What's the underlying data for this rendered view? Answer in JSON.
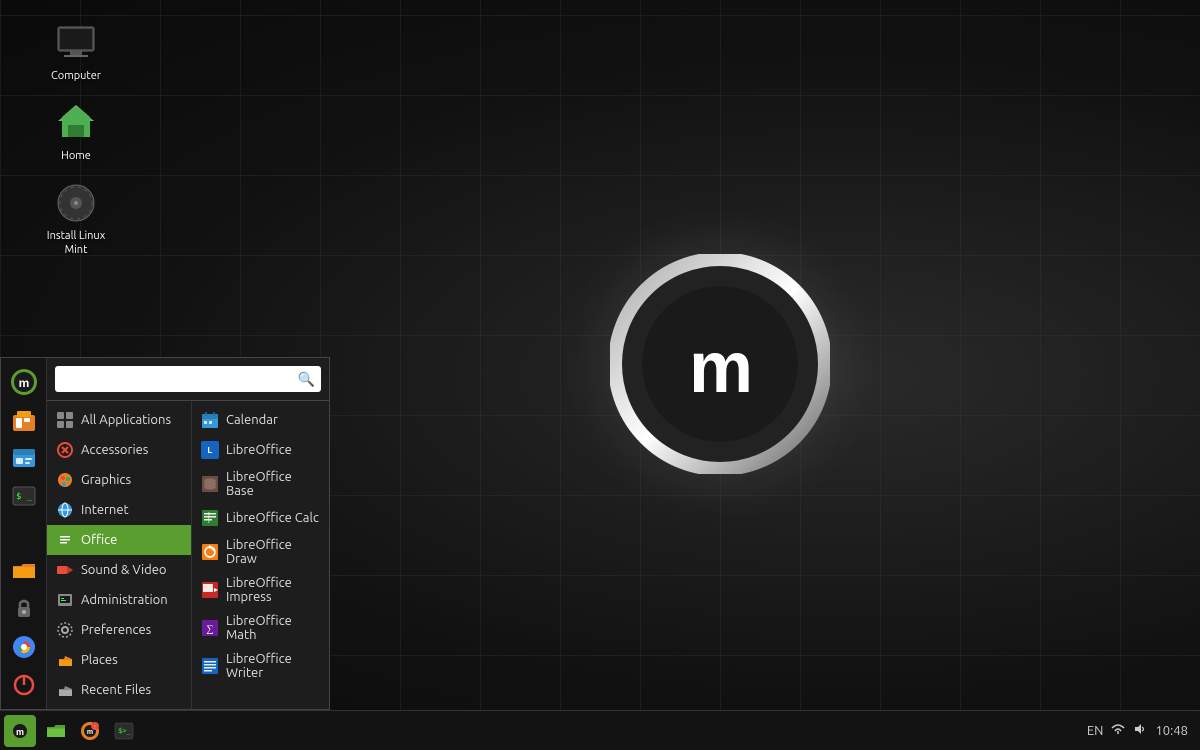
{
  "desktop": {
    "background": "dark grid",
    "icons": [
      {
        "id": "computer",
        "label": "Computer",
        "type": "computer"
      },
      {
        "id": "home",
        "label": "Home",
        "type": "folder-green"
      },
      {
        "id": "install",
        "label": "Install Linux Mint",
        "type": "dvd"
      }
    ]
  },
  "start_menu": {
    "search_placeholder": "",
    "categories": [
      {
        "id": "all-apps",
        "label": "All Applications",
        "icon": "grid"
      },
      {
        "id": "accessories",
        "label": "Accessories",
        "icon": "accessories"
      },
      {
        "id": "graphics",
        "label": "Graphics",
        "icon": "graphics"
      },
      {
        "id": "internet",
        "label": "Internet",
        "icon": "internet"
      },
      {
        "id": "office",
        "label": "Office",
        "icon": "office",
        "active": true
      },
      {
        "id": "sound-video",
        "label": "Sound & Video",
        "icon": "sound"
      },
      {
        "id": "administration",
        "label": "Administration",
        "icon": "admin"
      },
      {
        "id": "preferences",
        "label": "Preferences",
        "icon": "preferences"
      },
      {
        "id": "places",
        "label": "Places",
        "icon": "places"
      },
      {
        "id": "recent-files",
        "label": "Recent Files",
        "icon": "recent"
      }
    ],
    "apps": [
      {
        "id": "calendar",
        "label": "Calendar",
        "icon": "calendar"
      },
      {
        "id": "libreoffice",
        "label": "LibreOffice",
        "icon": "lo-main"
      },
      {
        "id": "libreoffice-base",
        "label": "LibreOffice Base",
        "icon": "lo-base"
      },
      {
        "id": "libreoffice-calc",
        "label": "LibreOffice Calc",
        "icon": "lo-calc"
      },
      {
        "id": "libreoffice-draw",
        "label": "LibreOffice Draw",
        "icon": "lo-draw"
      },
      {
        "id": "libreoffice-impress",
        "label": "LibreOffice Impress",
        "icon": "lo-impress"
      },
      {
        "id": "libreoffice-math",
        "label": "LibreOffice Math",
        "icon": "lo-math"
      },
      {
        "id": "libreoffice-writer",
        "label": "LibreOffice Writer",
        "icon": "lo-writer"
      }
    ]
  },
  "taskbar": {
    "left_buttons": [
      {
        "id": "mint-menu",
        "icon": "mint"
      },
      {
        "id": "files",
        "icon": "folder"
      },
      {
        "id": "firefox",
        "icon": "firefox"
      },
      {
        "id": "terminal",
        "icon": "terminal"
      }
    ],
    "tray": {
      "keyboard": "EN",
      "volume": "♪",
      "time": "10:48"
    }
  }
}
